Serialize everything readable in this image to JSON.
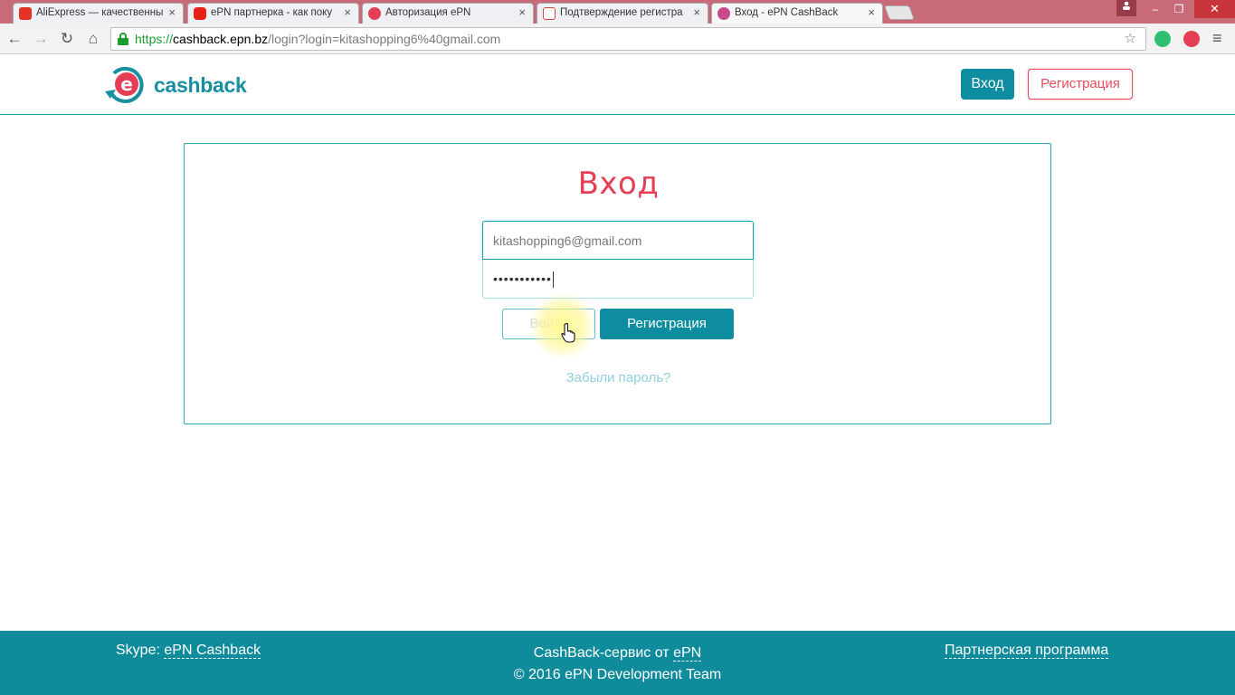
{
  "browser": {
    "tabs": [
      {
        "title": "AliExpress — качественны",
        "favicon_color": "#e43225"
      },
      {
        "title": "ePN партнерка - как поку",
        "favicon_color": "#e62117"
      },
      {
        "title": "Авторизация ePN",
        "favicon_color": "#e43f55"
      },
      {
        "title": "Подтверждение регистра",
        "favicon_color": "#d44638"
      },
      {
        "title": "Вход - ePN CashBack",
        "favicon_color": "#c84a8a"
      }
    ],
    "tab_close_glyph": "×",
    "url": {
      "scheme": "https://",
      "host": "cashback.epn.bz",
      "path": "/login?login=kitashopping6%40gmail.com"
    }
  },
  "header": {
    "logo_text": "cashback",
    "login_label": "Вход",
    "register_label": "Регистрация"
  },
  "form": {
    "title": "Вход",
    "email_value": "kitashopping6@gmail.com",
    "password_mask": "•••••••••••",
    "login_button": "Войти",
    "register_button": "Регистрация",
    "forgot_link": "Забыли пароль?"
  },
  "footer": {
    "skype_label": "Skype:",
    "skype_link": "ePN Cashback",
    "service_text": "CashBack-сервис от",
    "service_link": "ePN",
    "copyright": "© 2016 ePN Development Team",
    "partner_link": "Партнерская программа"
  },
  "colors": {
    "accent": "#0e8da0",
    "brand_red": "#e43f55",
    "footer_bg": "#0f8b9c"
  }
}
